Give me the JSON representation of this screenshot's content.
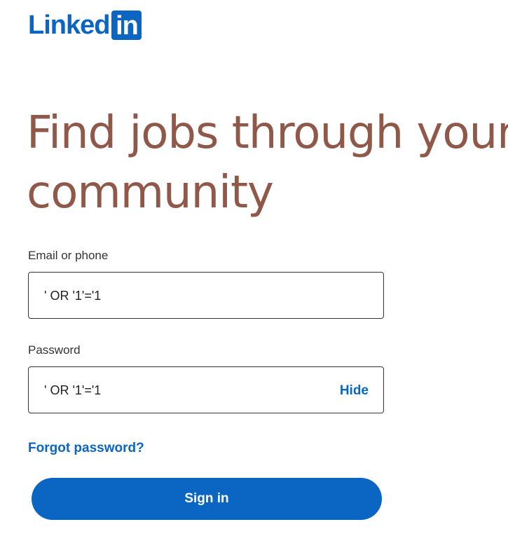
{
  "brand": {
    "logo_text": "Linked",
    "logo_box_text": "in",
    "color": "#0a66c2"
  },
  "headline": {
    "line1": "Find jobs through your",
    "line2": "community",
    "color": "#8f5849"
  },
  "email": {
    "label": "Email or phone",
    "value": "' OR '1'='1"
  },
  "password": {
    "label": "Password",
    "value": "' OR '1'='1",
    "toggle_label": "Hide"
  },
  "forgot_password": "Forgot password?",
  "sign_in_label": "Sign in"
}
